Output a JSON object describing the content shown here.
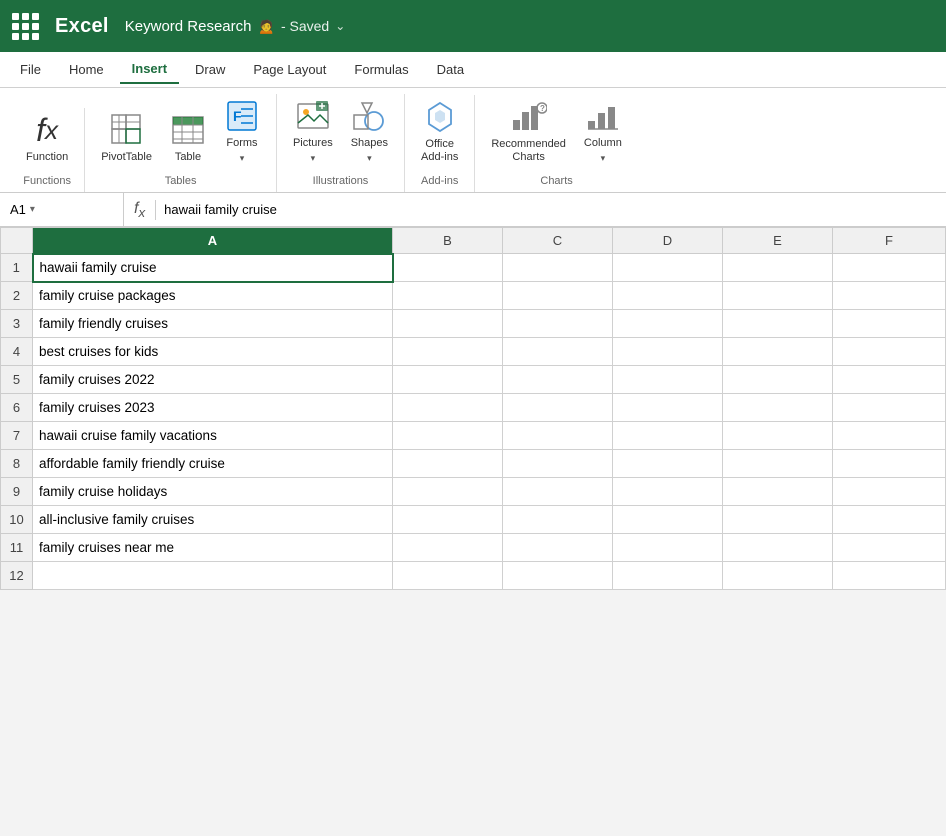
{
  "titlebar": {
    "app_name": "Excel",
    "doc_title": "Keyword Research",
    "collab_icon": "🙍",
    "status": "Saved",
    "dropdown_arrow": "⌄"
  },
  "menubar": {
    "items": [
      {
        "label": "File",
        "active": false
      },
      {
        "label": "Home",
        "active": false
      },
      {
        "label": "Insert",
        "active": true
      },
      {
        "label": "Draw",
        "active": false
      },
      {
        "label": "Page Layout",
        "active": false
      },
      {
        "label": "Formulas",
        "active": false
      },
      {
        "label": "Data",
        "active": false
      }
    ]
  },
  "ribbon": {
    "groups": [
      {
        "name": "Functions",
        "label": "Functions",
        "items": [
          {
            "name": "function",
            "label": "Function",
            "icon": "fx",
            "caret": false
          }
        ]
      },
      {
        "name": "Tables",
        "label": "Tables",
        "items": [
          {
            "name": "pivottable",
            "label": "PivotTable",
            "icon": "pivottable",
            "caret": false
          },
          {
            "name": "table",
            "label": "Table",
            "icon": "table",
            "caret": false
          },
          {
            "name": "forms",
            "label": "Forms",
            "icon": "forms",
            "caret": true
          }
        ]
      },
      {
        "name": "Illustrations",
        "label": "Illustrations",
        "items": [
          {
            "name": "pictures",
            "label": "Pictures",
            "icon": "pictures",
            "caret": true
          },
          {
            "name": "shapes",
            "label": "Shapes",
            "icon": "shapes",
            "caret": true
          }
        ]
      },
      {
        "name": "Add-ins",
        "label": "Add-ins",
        "items": [
          {
            "name": "office-addins",
            "label": "Office\nAdd-ins",
            "icon": "addins",
            "caret": false
          }
        ]
      },
      {
        "name": "Charts",
        "label": "Charts",
        "items": [
          {
            "name": "recommended-charts",
            "label": "Recommended\nCharts",
            "icon": "reccharts",
            "caret": false
          },
          {
            "name": "column",
            "label": "Column",
            "icon": "column",
            "caret": true
          }
        ]
      }
    ]
  },
  "formulabar": {
    "cell_ref": "A1",
    "formula": "hawaii family cruise"
  },
  "sheet": {
    "columns": [
      "",
      "A",
      "B",
      "C",
      "D",
      "E",
      "F"
    ],
    "rows": [
      {
        "row": 1,
        "A": "hawaii family cruise",
        "selected": true
      },
      {
        "row": 2,
        "A": "family cruise packages"
      },
      {
        "row": 3,
        "A": "family friendly cruises"
      },
      {
        "row": 4,
        "A": "best cruises for kids"
      },
      {
        "row": 5,
        "A": "family cruises 2022"
      },
      {
        "row": 6,
        "A": "family cruises 2023"
      },
      {
        "row": 7,
        "A": "hawaii cruise family vacations"
      },
      {
        "row": 8,
        "A": "affordable family friendly cruise"
      },
      {
        "row": 9,
        "A": "family cruise holidays"
      },
      {
        "row": 10,
        "A": "all-inclusive family cruises"
      },
      {
        "row": 11,
        "A": "family cruises near me"
      },
      {
        "row": 12,
        "A": ""
      }
    ]
  }
}
